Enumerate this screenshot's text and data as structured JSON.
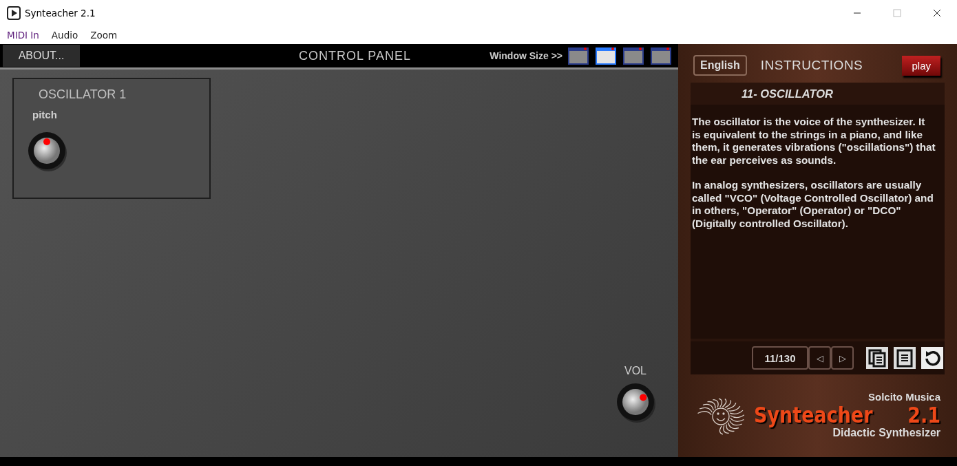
{
  "window": {
    "title": "Synteacher 2.1"
  },
  "menu": [
    "MIDI In",
    "Audio",
    "Zoom"
  ],
  "control_panel": {
    "about_button": "ABOUT...",
    "title": "CONTROL PANEL",
    "window_size_label": "Window Size >>",
    "window_sizes": [
      {
        "selected": false
      },
      {
        "selected": true
      },
      {
        "selected": false
      },
      {
        "selected": false
      }
    ],
    "modules": [
      {
        "title": "OSCILLATOR 1",
        "knobs": [
          {
            "label": "pitch",
            "level": 0.5
          }
        ]
      }
    ],
    "volume": {
      "label": "VOL",
      "level": 0.72
    }
  },
  "instructions": {
    "language_button": "English",
    "title": "INSTRUCTIONS",
    "play_button": "play",
    "lesson_title": "11- OSCILLATOR",
    "paragraphs": [
      "The oscillator is the voice of the synthesizer. It is equivalent to the strings in a piano, and like them, it generates vibrations (\"oscillations\") that the ear perceives as sounds.",
      "In analog synthesizers, oscillators are usually called \"VCO\" (Voltage Controlled Oscillator) and in others, \"Operator\" (Operator) or \"DCO\" (Digitally controlled Oscillator)."
    ],
    "page": "11/130",
    "prev_button": "◁",
    "next_button": "▷"
  },
  "brand": {
    "company": "Solcito Musica",
    "name": "Synteacher",
    "version": "2.1",
    "tagline": "Didactic Synthesizer"
  }
}
